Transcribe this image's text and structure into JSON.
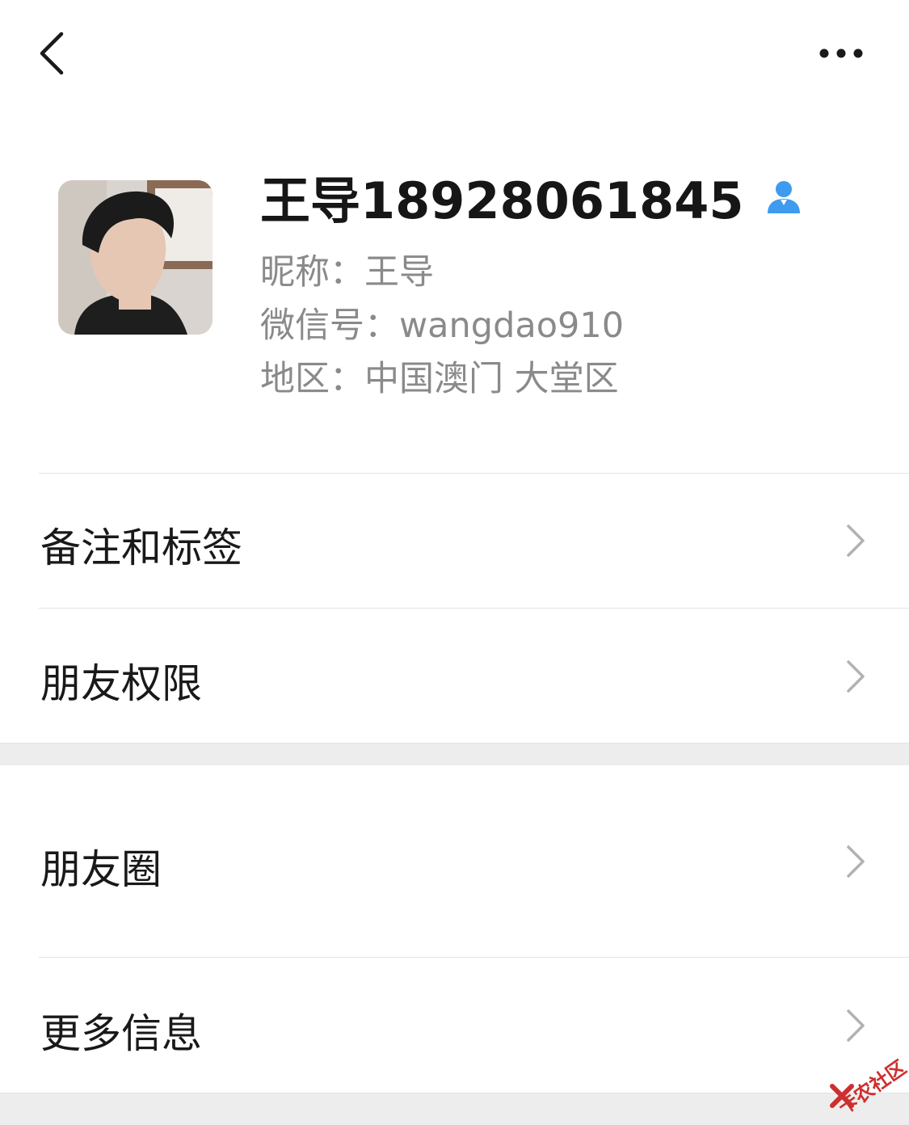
{
  "nav": {
    "back_icon": "chevron-left-icon",
    "more_icon": "ellipsis-icon"
  },
  "profile": {
    "avatar_icon": "person-photo",
    "name": "王导18928061845",
    "gender_icon": "person-icon",
    "gender_color": "#3d9bf0",
    "nickname_label": "昵称：",
    "nickname": "王导",
    "wechat_id_label": "微信号：",
    "wechat_id": "wangdao910",
    "region_label": "地区：",
    "region": "中国澳门 大堂区"
  },
  "menu": [
    {
      "label": "备注和标签"
    },
    {
      "label": "朋友权限"
    },
    {
      "label": "朋友圈"
    },
    {
      "label": "更多信息"
    }
  ],
  "watermark": {
    "text": "卡农社区"
  },
  "colors": {
    "separator_gray": "#ededed",
    "chevron": "#b2b2b2"
  }
}
